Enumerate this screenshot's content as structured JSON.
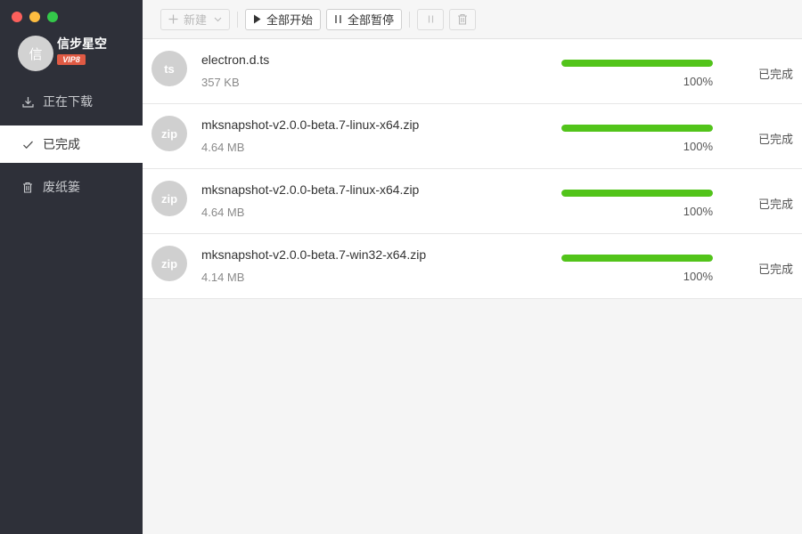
{
  "window": {
    "traffic_lights": {
      "close": "#fc605c",
      "minimize": "#fdbc40",
      "maximize": "#34c84a"
    }
  },
  "user": {
    "avatar_text": "信",
    "name": "信步星空",
    "badge": "VIP8"
  },
  "sidebar": {
    "items": [
      {
        "label": "正在下载",
        "icon": "download-icon",
        "active": false
      },
      {
        "label": "已完成",
        "icon": "check-icon",
        "active": true
      },
      {
        "label": "废纸篓",
        "icon": "trash-icon",
        "active": false
      }
    ]
  },
  "toolbar": {
    "new_label": "新建",
    "start_all_label": "全部开始",
    "pause_all_label": "全部暂停"
  },
  "downloads": [
    {
      "ext": "ts",
      "name": "electron.d.ts",
      "size": "357 KB",
      "progress": 1.0,
      "percent": "100%",
      "status": "已完成"
    },
    {
      "ext": "zip",
      "name": "mksnapshot-v2.0.0-beta.7-linux-x64.zip",
      "size": "4.64 MB",
      "progress": 1.0,
      "percent": "100%",
      "status": "已完成"
    },
    {
      "ext": "zip",
      "name": "mksnapshot-v2.0.0-beta.7-linux-x64.zip",
      "size": "4.64 MB",
      "progress": 1.0,
      "percent": "100%",
      "status": "已完成"
    },
    {
      "ext": "zip",
      "name": "mksnapshot-v2.0.0-beta.7-win32-x64.zip",
      "size": "4.14 MB",
      "progress": 1.0,
      "percent": "100%",
      "status": "已完成"
    }
  ],
  "colors": {
    "sidebar_bg": "#2e3039",
    "progress": "#52c41a",
    "vip_badge": "#e05a44"
  }
}
